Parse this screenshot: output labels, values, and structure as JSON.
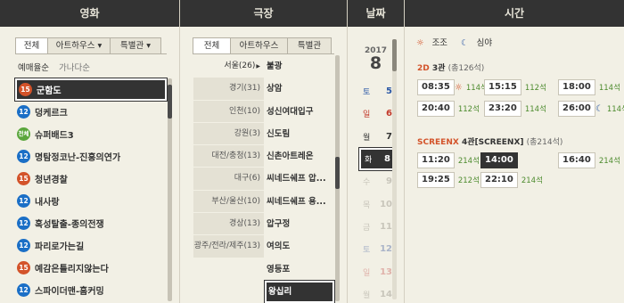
{
  "headers": {
    "movie": "영화",
    "theater": "극장",
    "date": "날짜",
    "time": "시간"
  },
  "movie": {
    "tabs": [
      {
        "label": "전체"
      },
      {
        "label": "아트하우스 ▾"
      },
      {
        "label": "특별관 ▾"
      }
    ],
    "sort": {
      "reservation": "예매율순",
      "alphabet": "가나다순"
    },
    "items": [
      {
        "rating": "15",
        "title": "군함도"
      },
      {
        "rating": "12",
        "title": "덩케르크"
      },
      {
        "rating": "전체",
        "title": "슈퍼배드3"
      },
      {
        "rating": "12",
        "title": "명탐정코난-진홍의연가"
      },
      {
        "rating": "15",
        "title": "청년경찰"
      },
      {
        "rating": "12",
        "title": "내사랑"
      },
      {
        "rating": "12",
        "title": "혹성탈출-종의전쟁"
      },
      {
        "rating": "12",
        "title": "파리로가는길"
      },
      {
        "rating": "15",
        "title": "예감은틀리지않는다"
      },
      {
        "rating": "12",
        "title": "스파이더맨-홈커밍"
      }
    ]
  },
  "theater": {
    "tabs": [
      {
        "label": "전체"
      },
      {
        "label": "아트하우스"
      },
      {
        "label": "특별관"
      }
    ],
    "regions": [
      {
        "label": "서울(26)",
        "arrow": "▶"
      },
      {
        "label": "경기(31)"
      },
      {
        "label": "인천(10)"
      },
      {
        "label": "강원(3)"
      },
      {
        "label": "대전/충청(13)"
      },
      {
        "label": "대구(6)"
      },
      {
        "label": "부산/울산(10)"
      },
      {
        "label": "경상(13)"
      },
      {
        "label": "광주/전라/제주(13)"
      }
    ],
    "cinemas": [
      {
        "label": "불광"
      },
      {
        "label": "상암"
      },
      {
        "label": "성신여대입구"
      },
      {
        "label": "신도림"
      },
      {
        "label": "신촌아트레온"
      },
      {
        "label": "씨네드쉐프 압..."
      },
      {
        "label": "씨네드쉐프 용..."
      },
      {
        "label": "압구정"
      },
      {
        "label": "여의도"
      },
      {
        "label": "영등포"
      },
      {
        "label": "왕십리"
      }
    ]
  },
  "date": {
    "year": "2017",
    "month": "8",
    "days": [
      {
        "dow": "토",
        "day": "5",
        "color": "#2b58a6"
      },
      {
        "dow": "일",
        "day": "6",
        "color": "#c33a2c"
      },
      {
        "dow": "월",
        "day": "7",
        "color": "#333333"
      },
      {
        "dow": "화",
        "day": "8",
        "color": "#ffffff"
      },
      {
        "dow": "수",
        "day": "9",
        "color": "#c8c5ba"
      },
      {
        "dow": "목",
        "day": "10",
        "color": "#c8c5ba"
      },
      {
        "dow": "금",
        "day": "11",
        "color": "#c8c5ba"
      },
      {
        "dow": "토",
        "day": "12",
        "color": "#aab4c8"
      },
      {
        "dow": "일",
        "day": "13",
        "color": "#e0b2aa"
      },
      {
        "dow": "월",
        "day": "14",
        "color": "#c8c5ba"
      }
    ]
  },
  "time": {
    "legend": {
      "morning": "조조",
      "night": "심야"
    },
    "screens": [
      {
        "format": "2D",
        "name": "3관",
        "seats": "(총126석)",
        "showtimes": [
          {
            "time": "08:35",
            "seats": "114석",
            "icon": "sun"
          },
          {
            "time": "15:15",
            "seats": "112석"
          },
          {
            "time": "18:00",
            "seats": "114석"
          },
          {
            "time": "20:40",
            "seats": "112석"
          },
          {
            "time": "23:20",
            "seats": "114석"
          },
          {
            "time": "26:00",
            "seats": "114석",
            "icon": "moon"
          }
        ]
      },
      {
        "format": "SCREENX",
        "name": "4관[SCREENX]",
        "seats": "(총214석)",
        "showtimes": [
          {
            "time": "11:20",
            "seats": "214석"
          },
          {
            "time": "14:00",
            "seats": ""
          },
          {
            "time": "16:40",
            "seats": "214석"
          },
          {
            "time": "19:25",
            "seats": "212석"
          },
          {
            "time": "22:10",
            "seats": "214석"
          }
        ]
      }
    ]
  },
  "selected": {
    "movie": 0,
    "cinema": 10,
    "day": 3,
    "screen": 1,
    "showtime": 1
  }
}
